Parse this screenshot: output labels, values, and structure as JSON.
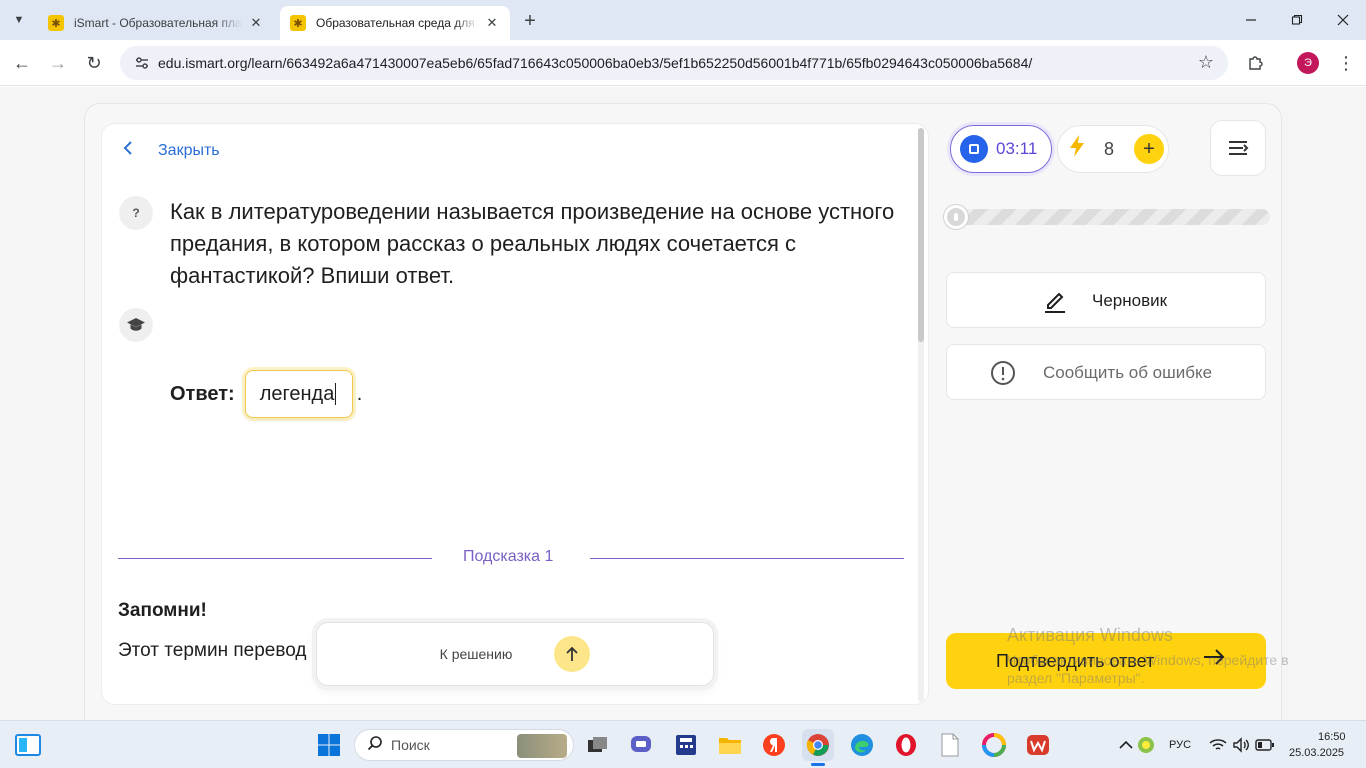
{
  "browser": {
    "tabs": [
      {
        "title": "iSmart - Образовательная платформа",
        "active": false
      },
      {
        "title": "Образовательная среда для самостоятельного обучения",
        "active": true
      }
    ],
    "url": "edu.ismart.org/learn/663492a6a471430007ea5eb6/65fad716643c050006ba0eb3/5ef1b652250d56001b4f771b/65fb0294643c050006ba5684/",
    "profile_initial": "Э"
  },
  "lesson": {
    "close_label": "Закрыть",
    "question_badge": "?",
    "question_text": "Как в литературоведении называется произведение на основе устного предания, в котором рассказ о реальных людях сочетается с фантастикой? Впиши ответ.",
    "answer_label": "Ответ:",
    "answer_value": "легенда",
    "answer_suffix": ".",
    "hint_label": "Подсказка 1",
    "remember_title": "Запомни!",
    "term_text": "Этот термин перевод                                                                                итано».",
    "to_solution_label": "К решению"
  },
  "sidebar": {
    "timer": "03:11",
    "energy": "8",
    "progress_fraction": 0.0,
    "draft_label": "Черновик",
    "report_label": "Сообщить об ошибке",
    "confirm_label": "Подтвердить ответ"
  },
  "watermark": {
    "title": "Активация Windows",
    "subtitle": "Чтобы активировать Windows, перейдите в раздел \"Параметры\"."
  },
  "taskbar": {
    "search_placeholder": "Поиск",
    "language": "РУС",
    "time": "16:50",
    "date": "25.03.2025"
  },
  "colors": {
    "accent_yellow": "#ffd20f",
    "link_blue": "#2b6fd6",
    "hint_purple": "#7b5fc7",
    "timer_blue": "#2563eb"
  }
}
